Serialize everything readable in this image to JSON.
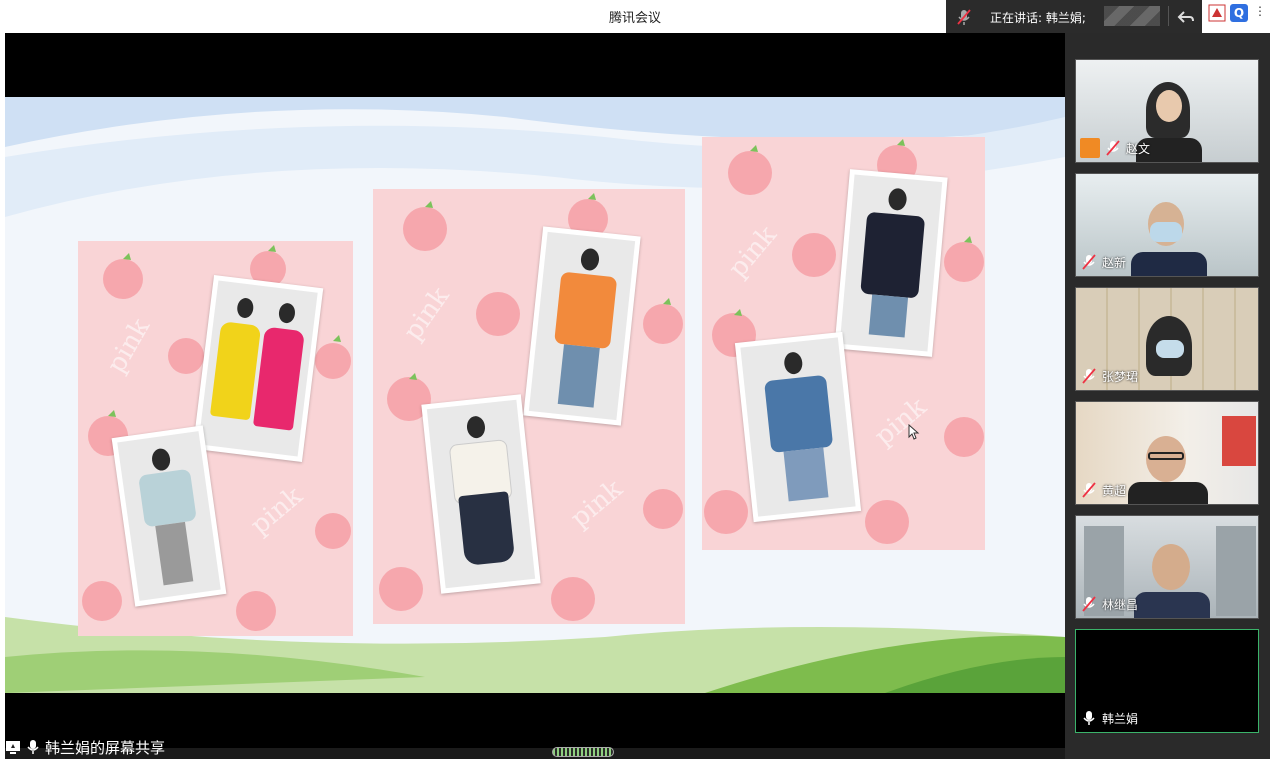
{
  "window": {
    "title": "腾讯会议"
  },
  "speaking": {
    "label": "正在讲话: 韩兰娟;"
  },
  "share": {
    "label": "韩兰娟的屏幕共享"
  },
  "slide": {
    "watermark": "pink"
  },
  "participants": [
    {
      "name": "赵文",
      "has_avatar_badge": true
    },
    {
      "name": "赵新"
    },
    {
      "name": "张梦珺"
    },
    {
      "name": "黄超"
    },
    {
      "name": "林继昌"
    },
    {
      "name": "韩兰娟",
      "active": true
    }
  ],
  "colors": {
    "active_border": "#3bb36a",
    "board": "#f9d4d6",
    "accent": "#f08a24"
  },
  "icons": [
    "mic-muted-icon",
    "back-arrow-icon",
    "mic-icon",
    "screen-share-icon",
    "peach-icon"
  ]
}
